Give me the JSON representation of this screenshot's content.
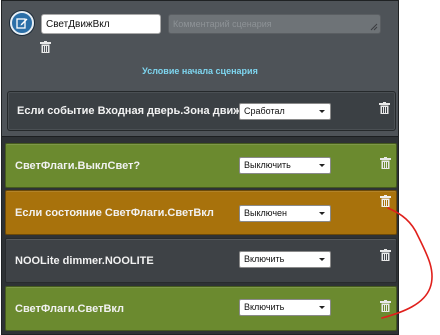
{
  "header": {
    "scenario_name": "СветДвижВкл",
    "description_placeholder": "Комментарий сценария",
    "section_title": "Условие начала сценария"
  },
  "trigger": {
    "label": "Если событие Входная дверь.Зона движения",
    "select_value": "Сработал"
  },
  "rows": [
    {
      "label": "СветФлаги.ВыклСвет?",
      "select_value": "Выключить",
      "color": "#6b8a2f"
    },
    {
      "label": "Если состояние СветФлаги.СветВкл",
      "select_value": "Выключен",
      "color": "#a8720c"
    },
    {
      "label": "NOOLite dimmer.NOOLITE",
      "select_value": "Включить",
      "color": "#3e4246"
    },
    {
      "label": "СветФлаги.СветВкл",
      "select_value": "Включить",
      "color": "#6b8a2f"
    }
  ],
  "icons": {
    "edit": "edit-icon",
    "trash": "trash-icon",
    "dropdown": "chevron-down-icon",
    "annotation": "red-curve-annotation"
  },
  "colors": {
    "accent_cyan": "#7ed6f0",
    "annotation_red": "#e0201c"
  }
}
